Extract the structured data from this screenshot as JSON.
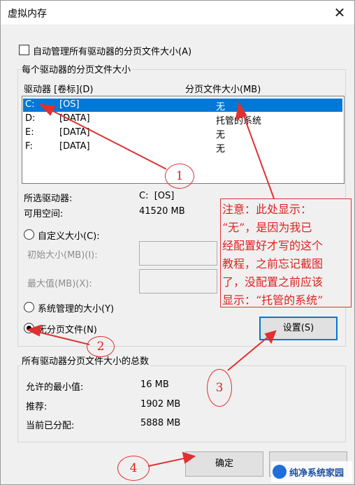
{
  "window": {
    "title": "虚拟内存",
    "close_glyph": "✕"
  },
  "auto_manage_label": "自动管理所有驱动器的分页文件大小(A)",
  "per_drive": {
    "group_label": "每个驱动器的分页文件大小",
    "col_drive": "驱动器 [卷标](D)",
    "col_size": "分页文件大小(MB)",
    "drives": [
      {
        "letter": "C:",
        "label": "[OS]",
        "size": "无"
      },
      {
        "letter": "D:",
        "label": "[DATA]",
        "size": "托管的系统"
      },
      {
        "letter": "E:",
        "label": "[DATA]",
        "size": "无"
      },
      {
        "letter": "F:",
        "label": "[DATA]",
        "size": "无"
      }
    ],
    "selected_drive_label": "所选驱动器:",
    "selected_drive_value": "C:  [OS]",
    "free_space_label": "可用空间:",
    "free_space_value": "41520 MB",
    "custom_size_label": "自定义大小(C):",
    "initial_size_label": "初始大小(MB)(I):",
    "max_size_label": "最大值(MB)(X):",
    "system_managed_label": "系统管理的大小(Y)",
    "no_paging_label": "无分页文件(N)",
    "set_button": "设置(S)"
  },
  "totals": {
    "group_label": "所有驱动器分页文件大小的总数",
    "min_label": "允许的最小值:",
    "min_value": "16 MB",
    "recommended_label": "推荐:",
    "recommended_value": "1902 MB",
    "allocated_label": "当前已分配:",
    "allocated_value": "5888 MB"
  },
  "buttons": {
    "ok": "确定",
    "cancel": ""
  },
  "annotations": {
    "note_lines": [
      "注意：此处显示：",
      "“无”，是因为我已",
      "经配置好才写的这个",
      "教程，之前忘记截图",
      "了，没配置之前应该",
      "显示：“托管的系统”"
    ],
    "markers": [
      "1",
      "2",
      "3",
      "4"
    ],
    "color": "#e02020"
  },
  "watermark": "纯净系统家园"
}
